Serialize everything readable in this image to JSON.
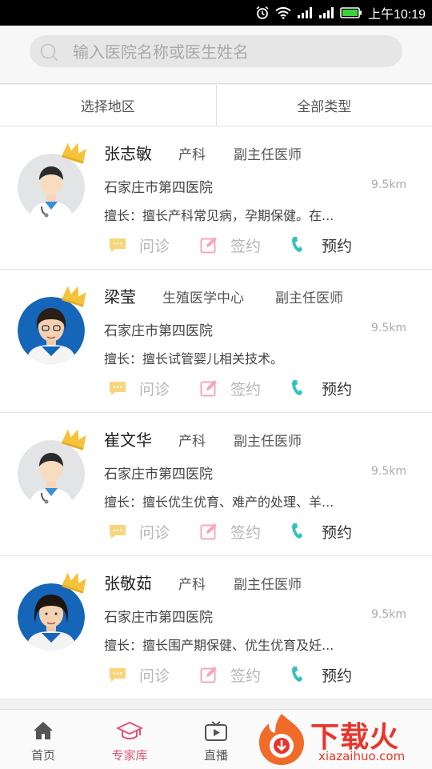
{
  "status_bar": {
    "time": "上午10:19"
  },
  "search": {
    "placeholder": "输入医院名称或医生姓名"
  },
  "filters": [
    {
      "label": "选择地区"
    },
    {
      "label": "全部类型"
    }
  ],
  "actions": {
    "consult": "问诊",
    "sign": "签约",
    "book": "预约"
  },
  "doctors": [
    {
      "name": "张志敏",
      "dept": "产科",
      "title": "副主任医师",
      "hospital": "石家庄市第四医院",
      "distance": "9.5km",
      "specialty": "擅长：擅长产科常见病，孕期保健。在...",
      "avatar": "default-male-doctor"
    },
    {
      "name": "梁莹",
      "dept": "生殖医学中心",
      "title": "副主任医师",
      "hospital": "石家庄市第四医院",
      "distance": "9.5km",
      "specialty": "擅长：擅长试管婴儿相关技术。",
      "avatar": "female-photo"
    },
    {
      "name": "崔文华",
      "dept": "产科",
      "title": "副主任医师",
      "hospital": "石家庄市第四医院",
      "distance": "9.5km",
      "specialty": "擅长：擅长优生优育、难产的处理、羊...",
      "avatar": "default-male-doctor"
    },
    {
      "name": "张敬茹",
      "dept": "产科",
      "title": "副主任医师",
      "hospital": "石家庄市第四医院",
      "distance": "9.5km",
      "specialty": "擅长：擅长围产期保健、优生优育及妊...",
      "avatar": "female-photo"
    }
  ],
  "bottom_nav": [
    {
      "label": "首页",
      "icon": "home-icon"
    },
    {
      "label": "专家库",
      "icon": "graduation-cap-icon",
      "active": true
    },
    {
      "label": "直播",
      "icon": "tv-play-icon"
    }
  ],
  "watermark": {
    "title": "下载火",
    "url": "xiazaihuo.com"
  },
  "colors": {
    "accent": "#e05577",
    "consult_icon": "#f7d57a",
    "sign_icon": "#f3a8bb",
    "phone_icon": "#2ec3bf",
    "crown": "#f5c33b"
  }
}
